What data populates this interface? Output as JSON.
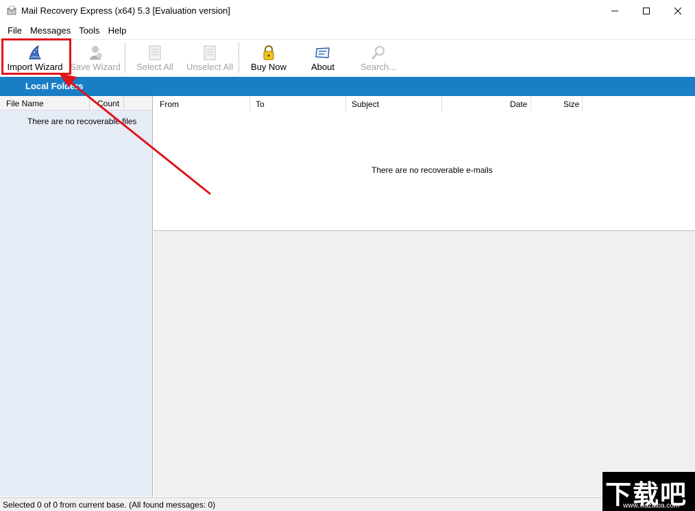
{
  "window": {
    "title": "Mail Recovery Express (x64) 5.3 [Evaluation version]"
  },
  "menu": {
    "items": [
      "File",
      "Messages",
      "Tools",
      "Help"
    ]
  },
  "toolbar": {
    "import_wizard": "Import Wizard",
    "save_wizard": "Save Wizard",
    "select_all": "Select All",
    "unselect_all": "Unselect All",
    "buy_now": "Buy Now",
    "about": "About",
    "search": "Search..."
  },
  "folders": {
    "header": "Local Folders",
    "columns": {
      "file_name": "File Name",
      "count": "Count"
    },
    "empty": "There are no recoverable files"
  },
  "messages": {
    "columns": {
      "from": "From",
      "to": "To",
      "subject": "Subject",
      "date": "Date",
      "size": "Size"
    },
    "empty": "There are no recoverable e-mails"
  },
  "status": {
    "text": "Selected 0 of 0 from current base. (All found messages: 0)"
  },
  "watermark": {
    "main": "下载吧",
    "sub": "www.xiazaiba.com"
  },
  "colors": {
    "accent_blue": "#1a7ec6",
    "highlight_red": "#e0141b",
    "left_pane_bg": "#e6ecf6"
  }
}
